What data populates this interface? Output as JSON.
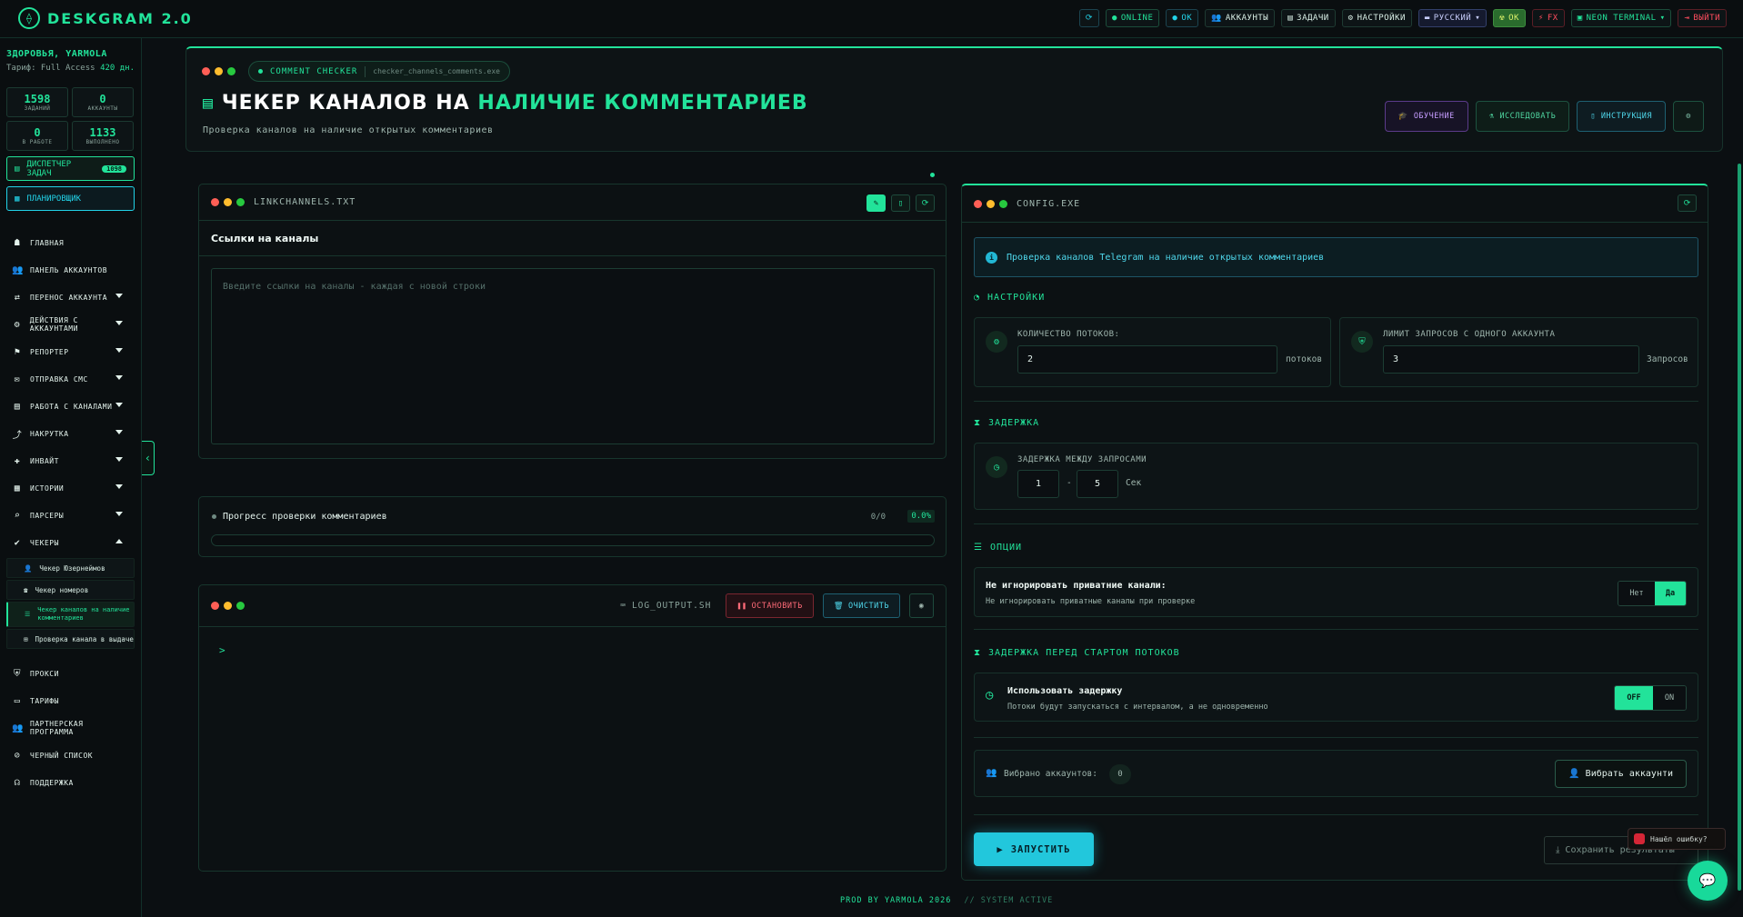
{
  "app": {
    "title": "DESKGRAM 2.0",
    "logo_glyph": "⟠"
  },
  "topbar": {
    "online": "ONLINE",
    "ok": "OK",
    "accounts": "АККАУНТЫ",
    "tasks": "ЗАДАЧИ",
    "settings": "НАСТРОЙКИ",
    "language": "РУССКИЙ",
    "ok2": "ОК",
    "fx": "FX",
    "theme": "NEON TERMINAL",
    "logout": "ВЫЙТИ"
  },
  "sidebar": {
    "user_name": "ЗДОРОВЬЯ, YARMOLA",
    "plan_label": "Тариф: Full Access",
    "plan_days": "420 дн.",
    "stats": [
      {
        "value": "1598",
        "label": "ЗАДАНИЙ"
      },
      {
        "value": "0",
        "label": "АККАУНТЫ"
      },
      {
        "value": "0",
        "label": "В РАБОТЕ"
      },
      {
        "value": "1133",
        "label": "ВЫПОЛНЕНО"
      }
    ],
    "dispatcher_label": "ДИСПЕТЧЕР ЗАДАЧ",
    "dispatcher_count": "1098",
    "scheduler_label": "ПЛАНИРОВЩИК",
    "items": [
      {
        "label": "ГЛАВНАЯ",
        "icon": "☗"
      },
      {
        "label": "ПАНЕЛЬ АККАУНТОВ",
        "icon": "👥"
      },
      {
        "label": "ПЕРЕНОС АККАУНТА",
        "icon": "⇄"
      },
      {
        "label": "ДЕЙСТВИЯ С АККАУНТАМИ",
        "icon": "⚙"
      },
      {
        "label": "РЕПОРТЕР",
        "icon": "⚑"
      },
      {
        "label": "ОТПРАВКА СМС",
        "icon": "✉"
      },
      {
        "label": "РАБОТА С КАНАЛАМИ",
        "icon": "▤"
      },
      {
        "label": "НАКРУТКА",
        "icon": "⤴"
      },
      {
        "label": "ИНВАЙТ",
        "icon": "✚"
      },
      {
        "label": "ИСТОРИИ",
        "icon": "▦"
      },
      {
        "label": "ПАРСЕРЫ",
        "icon": "⌕"
      },
      {
        "label": "ЧЕКЕРЫ",
        "icon": "✔"
      }
    ],
    "sub_items": [
      {
        "label": "Чекер Юзернеймов",
        "icon": "👤"
      },
      {
        "label": "Чекер номеров",
        "icon": "☎"
      },
      {
        "label": "Чекер каналов на наличие комментариев",
        "icon": "☰"
      },
      {
        "label": "Проверка канала в выдаче",
        "icon": "⊞"
      }
    ],
    "bottom_items": [
      {
        "label": "ПРОКСИ",
        "icon": "⛨"
      },
      {
        "label": "ТАРИФЫ",
        "icon": "▭"
      },
      {
        "label": "ПАРТНЕРСКАЯ ПРОГРАММА",
        "icon": "👥"
      },
      {
        "label": "ЧЕРНЫЙ СПИСОК",
        "icon": "⊘"
      },
      {
        "label": "ПОДДЕРЖКА",
        "icon": "☊"
      }
    ]
  },
  "header": {
    "chip_title": "COMMENT CHECKER",
    "chip_file": "checker_channels_comments.exe",
    "title_a": "ЧЕКЕР КАНАЛОВ НА ",
    "title_b": "НАЛИЧИЕ КОММЕНТАРИЕВ",
    "subtitle": "Проверка каналов на наличие открытых комментариев",
    "btn_learn": "ОБУЧЕНИЕ",
    "btn_explore": "ИССЛЕДОВАТЬ",
    "btn_manual": "ИНСТРУКЦИЯ"
  },
  "links": {
    "file": "LINKCHANNELS.TXT",
    "label": "Ссылки на каналы",
    "placeholder": "Введите ссылки на каналы - каждая с новой строки"
  },
  "progress": {
    "label": "Прогресс проверки комментариев",
    "count": "0/0",
    "percent_text": "0.0%",
    "fraction": 0
  },
  "log": {
    "file": "LOG_OUTPUT.SH",
    "stop": "ОСТАНОВИТЬ",
    "clear": "ОЧИСТИТЬ",
    "prompt": ">"
  },
  "config": {
    "file": "CONFIG.EXE",
    "notice": "Проверка каналов Telegram на наличие открытых комментариев",
    "section_settings": "НАСТРОЙКИ",
    "threads_label": "КОЛИЧЕСТВО ПОТОКОВ:",
    "threads_value": "2",
    "threads_unit": "потоков",
    "limit_label": "ЛИМИТ ЗАПРОСОВ С ОДНОГО АККАУНТА",
    "limit_value": "3",
    "limit_unit": "Запросов",
    "section_delay": "ЗАДЕРЖКА",
    "delay_label": "ЗАДЕРЖКА МЕЖДУ ЗАПРОСАМИ",
    "delay_min": "1",
    "delay_sep": "-",
    "delay_max": "5",
    "delay_unit": "Сек",
    "section_options": "ОПЦИИ",
    "opt_title": "Не игнорировать приватние канали:",
    "opt_desc": "Не игнорировать приватные каналы при проверке",
    "opt_no": "Нет",
    "opt_yes": "Да",
    "section_start_delay": "ЗАДЕРЖКА ПЕРЕД СТАРТОМ ПОТОКОВ",
    "use_delay_title": "Использовать задержку",
    "use_delay_desc": "Потоки будут запускаться с интервалом, а не одновременно",
    "toggle_off": "OFF",
    "toggle_on": "ON",
    "selected_label": "Вибрано аккаунтов:",
    "selected_count": "0",
    "choose_accounts": "Вибрать аккаунти",
    "start": "ЗАПУСТИТЬ",
    "save": "Сохранить результаты"
  },
  "float": {
    "bug": "Нашёл ошибку?"
  },
  "footer": {
    "prod": "PROD BY YARMOLA 2026",
    "status": "// SYSTEM ACTIVE"
  },
  "colors": {
    "accent": "#22e39a",
    "cyan": "#22d3e8",
    "bg": "#0b0f12",
    "danger": "#ff4d5e"
  }
}
